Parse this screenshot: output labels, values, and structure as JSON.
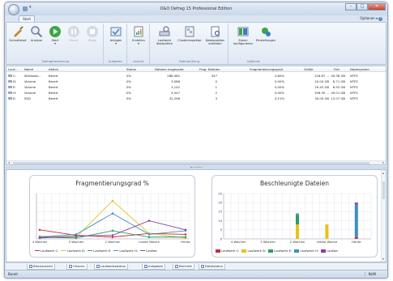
{
  "window": {
    "title": "O&O Defrag 15 Professional Edition",
    "tab": "Start",
    "options_label": "Optionen ▾",
    "help_icon": "?"
  },
  "ribbon": {
    "groups": [
      {
        "label": "Defragmentierung",
        "buttons": [
          "Schnellstart",
          "Analyse",
          "Start",
          "Pause",
          "Stopp"
        ]
      },
      {
        "label": "Aufgaben",
        "buttons": [
          "Anlegen"
        ]
      },
      {
        "label": "Ansicht",
        "buttons": [
          "Erstellen"
        ]
      },
      {
        "label": "Datenprüfung",
        "buttons": [
          "Laufwerk überprüfen",
          "Clusterinspektor",
          "Dateiposition ermitteln"
        ]
      },
      {
        "label": "Optionen",
        "buttons": [
          "Zonen konfigurieren",
          "Einstellungen"
        ]
      }
    ]
  },
  "grid": {
    "columns": [
      "Lauf...",
      "Name",
      "Aktion",
      "Status",
      "Dateien insgesamt",
      "Frag. Dateien",
      "Fragmentierungsgrad",
      "Größe",
      "Frei",
      "Dateisystem"
    ],
    "rows": [
      [
        "C:",
        "Windows...",
        "Bereit",
        "0%",
        "288,482",
        "547",
        "4.80%",
        "128.87 ...",
        "49.38 GB",
        "NTFS"
      ],
      [
        "D:",
        "Volume",
        "Bereit",
        "0%",
        "3,588",
        "0",
        "0.00%",
        "20.00 GB",
        "8.71 GB",
        "NTFS"
      ],
      [
        "E:",
        "Volume",
        "Bereit",
        "0%",
        "3,142",
        "1",
        "0.00%",
        "29.45 GB",
        "8.55 GB",
        "NTFS"
      ],
      [
        "H:",
        "Volume",
        "Bereit",
        "0%",
        "4,547",
        "2",
        "0.00%",
        "196.30 ...",
        "49.01 GB",
        "NTFS"
      ],
      [
        "K:",
        "SSD",
        "Bereit",
        "0%",
        "32,298",
        "3",
        "0.21%",
        "30.00 GB",
        "12.07 GB",
        "NTFS"
      ]
    ]
  },
  "view_tabs": [
    "Blockansicht",
    "Historie",
    "Laufwerksstatus",
    "Aufgaben",
    "Berichte",
    "Dateistatus"
  ],
  "statusbar": {
    "left": "Bereit",
    "right": "NUM"
  },
  "colors": {
    "laufwerk_c": "#c0303a",
    "laufwerk_d": "#e8c21a",
    "laufwerk_e": "#2e9a64",
    "laufwerk_h": "#3f8fbe",
    "laufwerk_k": "#8a3fa0"
  },
  "chart_data": [
    {
      "type": "line",
      "title": "Fragmentierungsgrad %",
      "categories": [
        "4 Wochen",
        "3 Wochen",
        "2 Wochen",
        "Letzte Woche",
        "Heute"
      ],
      "series": [
        {
          "name": "Laufwerk C:",
          "values": [
            1.0,
            0.4,
            0.2,
            0.6,
            0.5
          ]
        },
        {
          "name": "Laufwerk D:",
          "values": [
            0.3,
            0.2,
            4.2,
            0.6,
            0.1
          ]
        },
        {
          "name": "Laufwerk E:",
          "values": [
            0.2,
            0.1,
            0.9,
            0.2,
            0.2
          ]
        },
        {
          "name": "Laufwerk H:",
          "values": [
            0.2,
            0.5,
            2.8,
            0.5,
            0.9
          ]
        },
        {
          "name": "Laufwerk K:",
          "values": [
            0.1,
            0.3,
            0.4,
            2.0,
            1.0
          ]
        }
      ],
      "ylim": [
        0,
        5
      ],
      "grid": true,
      "legend": "bottom",
      "legend_labels": [
        "Laufwerk C:",
        "Laufwerk D:",
        "Laufwerk E:",
        "Laufwerk H:",
        "Laufwe"
      ]
    },
    {
      "type": "bar",
      "stacked": true,
      "title": "Beschleunigte Dateien",
      "categories": [
        "4 Wochen",
        "3 Wochen",
        "2 Wochen",
        "Letzte Woche",
        "Heute"
      ],
      "series": [
        {
          "name": "Laufwerk C:",
          "values": [
            0,
            0,
            0,
            0,
            1
          ]
        },
        {
          "name": "Laufwerk D:",
          "values": [
            0,
            0,
            8,
            8,
            0
          ]
        },
        {
          "name": "Laufwerk E:",
          "values": [
            0,
            0,
            5,
            0,
            0
          ]
        },
        {
          "name": "Laufwerk H:",
          "values": [
            0,
            0,
            1,
            0,
            18
          ]
        },
        {
          "name": "Laufwerk K:",
          "values": [
            0,
            0,
            0,
            0,
            1
          ]
        }
      ],
      "yticks": [
        0,
        5,
        10,
        15,
        20,
        25
      ],
      "ylim": [
        0,
        25
      ],
      "grid": true,
      "legend": "bottom",
      "legend_labels": [
        "Laufwerk C:",
        "Laufwerk D:",
        "Laufwerk E:",
        "Laufwerk H:",
        "Laufwe"
      ]
    }
  ]
}
